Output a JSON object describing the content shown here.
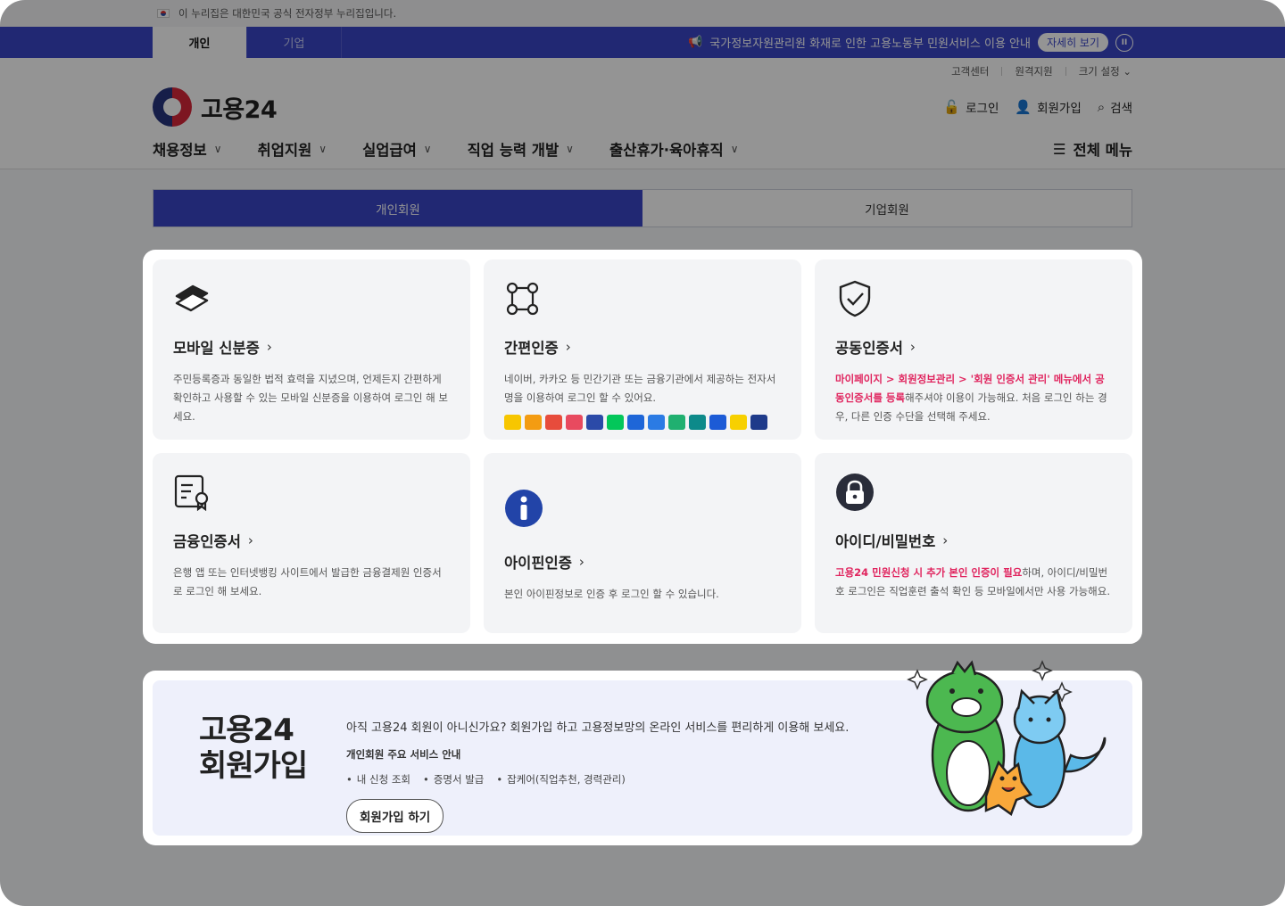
{
  "gov_notice": "이 누리집은 대한민국 공식 전자정부 누리집입니다.",
  "top_tabs": [
    {
      "label": "개인",
      "active": true
    },
    {
      "label": "기업",
      "active": false
    }
  ],
  "banner": {
    "text": "국가정보자원관리원 화재로 인한 고용노동부 민원서비스 이용 안내",
    "detail_label": "자세히 보기",
    "pause_icon": "pause-icon"
  },
  "util_links": [
    "고객센터",
    "원격지원",
    "크기 설정"
  ],
  "logo_text": "고용24",
  "header_actions": [
    "로그인",
    "회원가입",
    "검색"
  ],
  "gnb": [
    "채용정보",
    "취업지원",
    "실업급여",
    "직업 능력 개발",
    "출산휴가·육아휴직"
  ],
  "all_menu_label": "전체 메뉴",
  "member_tabs": [
    {
      "label": "개인회원",
      "active": true
    },
    {
      "label": "기업회원",
      "active": false
    }
  ],
  "cards": [
    {
      "title": "모바일 신분증",
      "icon": "mobile-id-icon",
      "desc": "주민등록증과 동일한 법적 효력을 지녔으며, 언제든지 간편하게 확인하고 사용할 수 있는 모바일 신분증을 이용하여 로그인 해 보세요."
    },
    {
      "title": "간편인증",
      "icon": "simple-auth-icon",
      "desc": "네이버, 카카오 등 민간기관 또는 금융기관에서 제공하는 전자서명을 이용하여 로그인 할 수 있어요."
    },
    {
      "title": "공동인증서",
      "icon": "shield-check-icon",
      "desc_hl": "마이페이지 > 회원정보관리 > '회원 인증서 관리' 메뉴에서 공동인증서를 등록",
      "desc": "해주셔야 이용이 가능해요. 처음 로그인 하는 경우, 다른 인증 수단을 선택해 주세요."
    },
    {
      "title": "금융인증서",
      "icon": "financial-cert-icon",
      "desc": "은행 앱 또는 인터넷뱅킹 사이트에서 발급한 금융결제원 인증서로 로그인 해 보세요."
    },
    {
      "title": "아이핀인증",
      "icon": "ipin-icon",
      "desc": "본인 아이핀정보로 인증 후 로그인 할 수 있습니다."
    },
    {
      "title": "아이디/비밀번호",
      "icon": "lock-icon",
      "desc_hl": "고용24 민원신청 시 추가 본인 인증이 필요",
      "desc": "하며, 아이디/비밀번호 로그인은 직업훈련 출석 확인 등 모바일에서만 사용 가능해요."
    }
  ],
  "badge_colors": [
    "#f7c600",
    "#f39c12",
    "#e74c3c",
    "#e84a5f",
    "#2b4aa8",
    "#03c75a",
    "#1e66d8",
    "#2b7be4",
    "#20b070",
    "#0d8a8a",
    "#1c5bd6",
    "#f7d000",
    "#1e3a8a"
  ],
  "signup": {
    "title_line1": "고용24",
    "title_line2": "회원가입",
    "lead": "아직 고용24 회원이 아니신가요? 회원가입 하고 고용정보망의 온라인 서비스를 편리하게 이용해 보세요.",
    "sub": "개인회원 주요 서비스 안내",
    "services": [
      "내 신청 조회",
      "증명서 발급",
      "잡케어(직업추천, 경력관리)"
    ],
    "button": "회원가입 하기"
  }
}
